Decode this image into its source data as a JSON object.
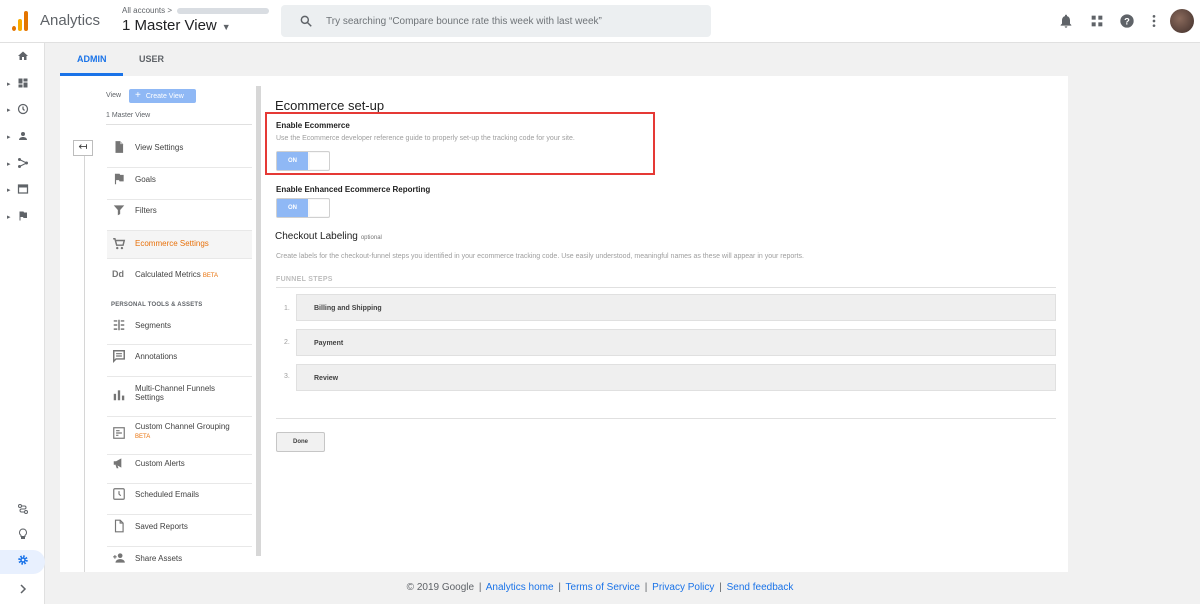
{
  "header": {
    "app_name": "Analytics",
    "account_crumb": "All accounts",
    "crumb_arrow": ">",
    "view_name": "1 Master View",
    "search_placeholder": "Try searching “Compare bounce rate this week with last week”",
    "logo_colors": [
      "#f9ab00",
      "#e37400"
    ]
  },
  "tabs": {
    "admin": "ADMIN",
    "user": "USER",
    "active_color": "#1a73e8"
  },
  "view_panel": {
    "header_label": "View",
    "create_view_label": "Create View",
    "view_name": "1 Master View",
    "back_glyph": "↤",
    "items": [
      {
        "label": "View Settings",
        "icon": "document-icon"
      },
      {
        "label": "Goals",
        "icon": "flag-icon"
      },
      {
        "label": "Filters",
        "icon": "filter-icon"
      },
      {
        "label": "Ecommerce Settings",
        "icon": "cart-icon",
        "active": true
      },
      {
        "label": "Calculated Metrics",
        "badge": "BETA",
        "icon": "dd-icon"
      }
    ],
    "section_label": "PERSONAL TOOLS & ASSETS",
    "personal_items": [
      {
        "label": "Segments",
        "icon": "segments-icon"
      },
      {
        "label": "Annotations",
        "icon": "comment-icon"
      },
      {
        "label": "Multi-Channel Funnels Settings",
        "icon": "bar-chart-icon"
      },
      {
        "label": "Custom Channel Grouping",
        "badge": "BETA",
        "icon": "grouping-icon"
      },
      {
        "label": "Custom Alerts",
        "icon": "megaphone-icon"
      },
      {
        "label": "Scheduled Emails",
        "icon": "clock-icon"
      },
      {
        "label": "Saved Reports",
        "icon": "document-icon"
      },
      {
        "label": "Share Assets",
        "icon": "person-add-icon"
      }
    ]
  },
  "ecommerce": {
    "title": "Ecommerce set-up",
    "enable_label": "Enable Ecommerce",
    "enable_help": "Use the Ecommerce developer reference guide to properly set-up the tracking code for your site.",
    "enable_state": "ON",
    "enhanced_label": "Enable Enhanced Ecommerce Reporting",
    "enhanced_state": "ON",
    "checkout_title": "Checkout Labeling",
    "checkout_optional": "optional",
    "checkout_help": "Create labels for the checkout-funnel steps you identified in your ecommerce tracking code. Use easily understood, meaningful names as these will appear in your reports.",
    "funnel_label": "FUNNEL STEPS",
    "steps": [
      {
        "num": "1.",
        "label": "Billing and Shipping"
      },
      {
        "num": "2.",
        "label": "Payment"
      },
      {
        "num": "3.",
        "label": "Review"
      }
    ],
    "done_label": "Done",
    "highlight_color": "#e53935"
  },
  "footer": {
    "copyright": "© 2019 Google",
    "analytics_home": "Analytics home",
    "terms": "Terms of Service",
    "privacy": "Privacy Policy",
    "feedback": "Send feedback",
    "separator": "|"
  }
}
